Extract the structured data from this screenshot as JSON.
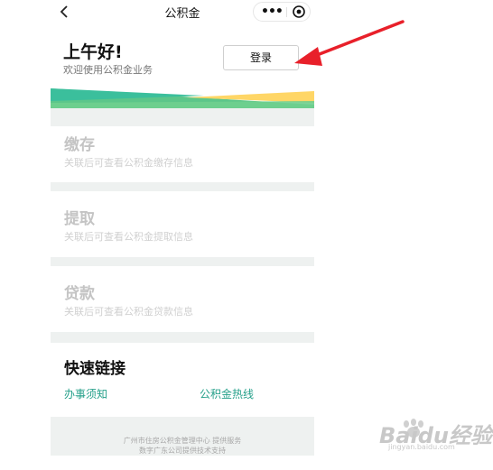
{
  "navbar": {
    "title": "公积金",
    "more": "•••"
  },
  "greeting": {
    "title": "上午好!",
    "subtitle": "欢迎使用公积金业务",
    "login_label": "登录"
  },
  "colors": {
    "accent_green": "#25a08a",
    "banner_green": "#5cc68a",
    "banner_teal": "#3bbf9c",
    "banner_yellow": "#ffd666",
    "arrow_red": "#e8202a"
  },
  "cards": [
    {
      "title": "缴存",
      "desc": "关联后可查看公积金缴存信息"
    },
    {
      "title": "提取",
      "desc": "关联后可查看公积金提取信息"
    },
    {
      "title": "贷款",
      "desc": "关联后可查看公积金贷款信息"
    }
  ],
  "quick_links": {
    "title": "快速链接",
    "items": [
      "办事须知",
      "公积金热线"
    ]
  },
  "footer": {
    "line1": "广州市住房公积金管理中心 提供服务",
    "line2": "数字广东公司提供技术支持"
  },
  "watermark": {
    "brand": "Baidu经验",
    "sub": "jingyan.baidu.com"
  }
}
